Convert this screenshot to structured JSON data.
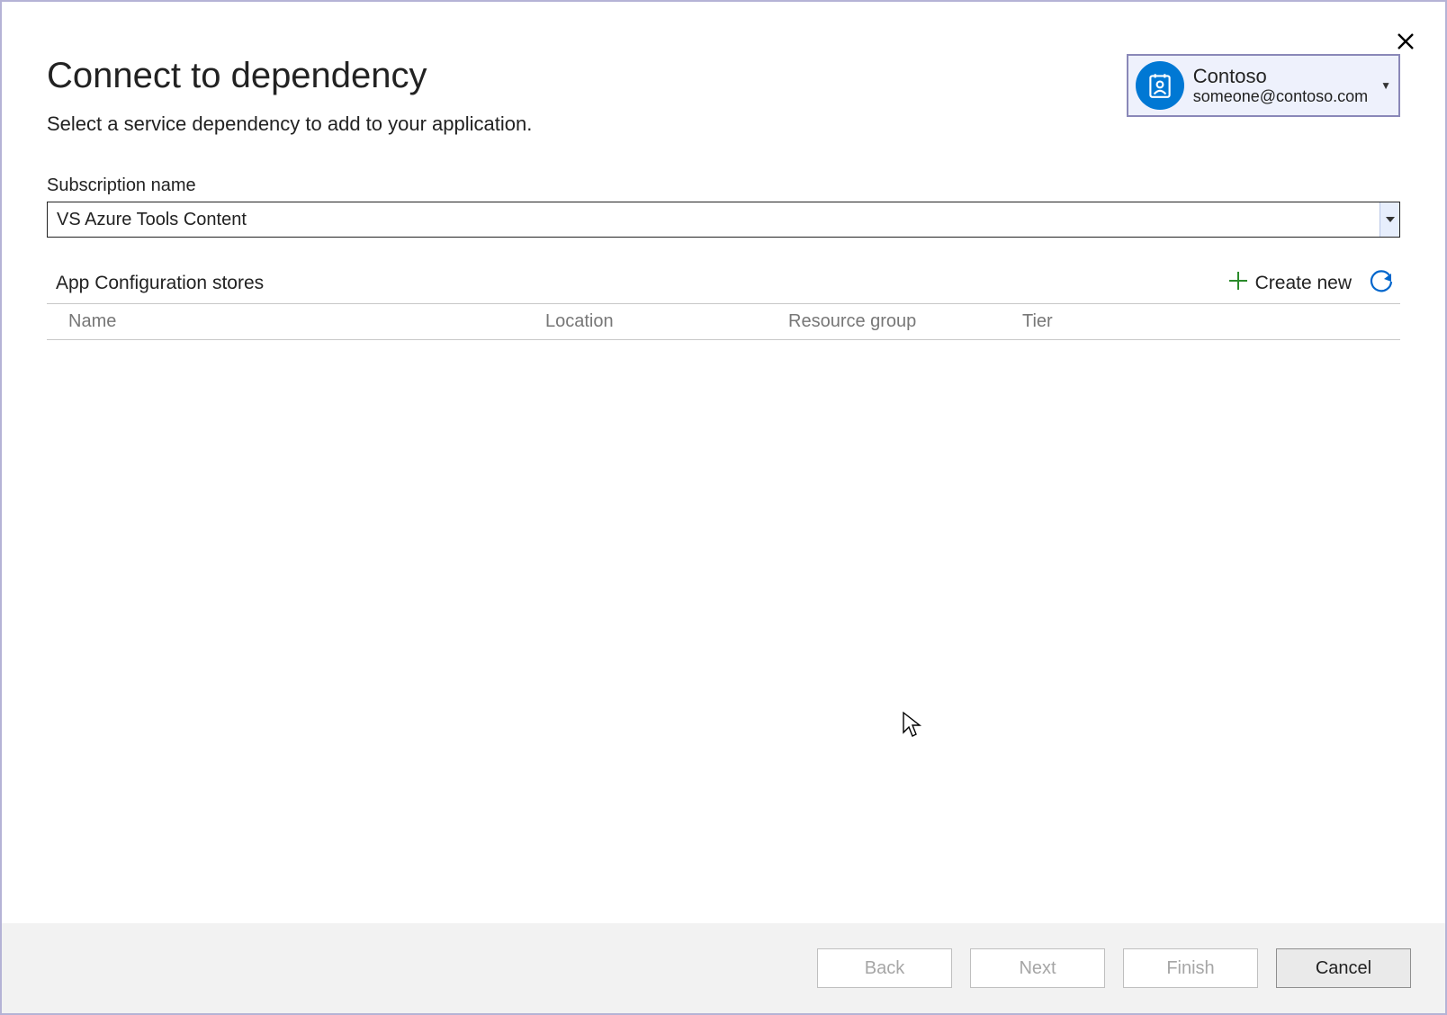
{
  "dialog": {
    "title": "Connect to dependency",
    "subtitle": "Select a service dependency to add to your application."
  },
  "account": {
    "org": "Contoso",
    "email": "someone@contoso.com"
  },
  "subscription": {
    "label": "Subscription name",
    "value": "VS Azure Tools Content"
  },
  "stores": {
    "section_label": "App Configuration stores",
    "create_new_label": "Create new",
    "columns": {
      "name": "Name",
      "location": "Location",
      "resource_group": "Resource group",
      "tier": "Tier"
    }
  },
  "buttons": {
    "back": "Back",
    "next": "Next",
    "finish": "Finish",
    "cancel": "Cancel"
  }
}
